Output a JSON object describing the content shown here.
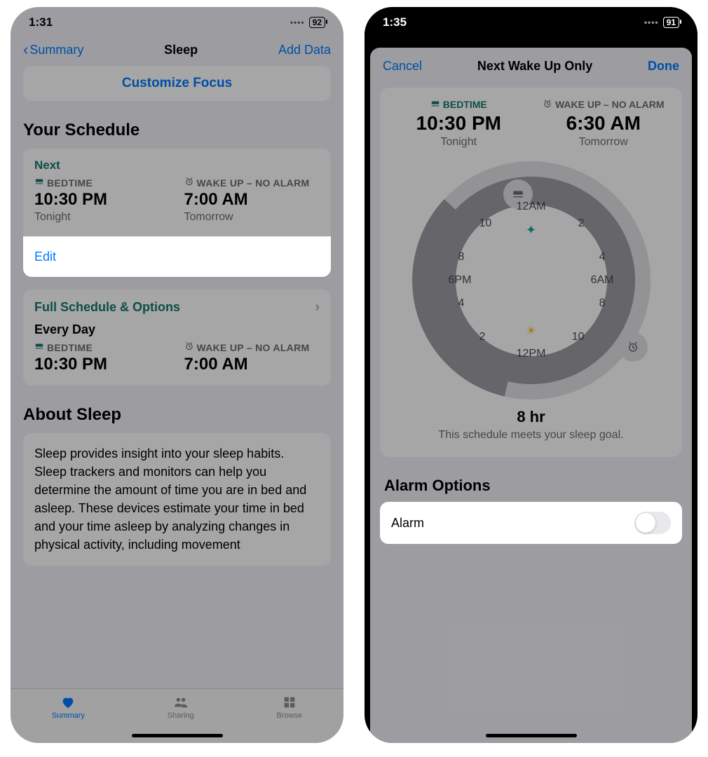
{
  "left": {
    "status": {
      "time": "1:31",
      "battery": "92"
    },
    "nav": {
      "back": "Summary",
      "title": "Sleep",
      "action": "Add Data"
    },
    "focus_button": "Customize Focus",
    "schedule_heading": "Your Schedule",
    "next": {
      "label": "Next",
      "bed_label": "BEDTIME",
      "bed_time": "10:30 PM",
      "bed_day": "Tonight",
      "wake_label": "WAKE UP – NO ALARM",
      "wake_time": "7:00 AM",
      "wake_day": "Tomorrow"
    },
    "edit_label": "Edit",
    "full": {
      "title": "Full Schedule & Options",
      "days": "Every Day",
      "bed_label": "BEDTIME",
      "bed_time": "10:30 PM",
      "wake_label": "WAKE UP – NO ALARM",
      "wake_time": "7:00 AM"
    },
    "about_heading": "About Sleep",
    "about_body": "Sleep provides insight into your sleep habits. Sleep trackers and monitors can help you determine the amount of time you are in bed and asleep. These devices estimate your time in bed and your time asleep by analyzing changes in physical activity, including movement",
    "tabs": {
      "summary": "Summary",
      "sharing": "Sharing",
      "browse": "Browse"
    }
  },
  "right": {
    "status": {
      "time": "1:35",
      "battery": "91"
    },
    "sheet_nav": {
      "cancel": "Cancel",
      "title": "Next Wake Up Only",
      "done": "Done"
    },
    "bed": {
      "label": "BEDTIME",
      "time": "10:30 PM",
      "day": "Tonight"
    },
    "wake": {
      "label": "WAKE UP – NO ALARM",
      "time": "6:30 AM",
      "day": "Tomorrow"
    },
    "clock": {
      "am12": "12AM",
      "pm12": "12PM",
      "am6": "6AM",
      "pm6": "6PM",
      "h2": "2",
      "h4": "4",
      "h8": "8",
      "h10": "10"
    },
    "goal": {
      "hours": "8 hr",
      "sub": "This schedule meets your sleep goal."
    },
    "alarm_heading": "Alarm Options",
    "alarm_label": "Alarm",
    "alarm_on": false
  }
}
